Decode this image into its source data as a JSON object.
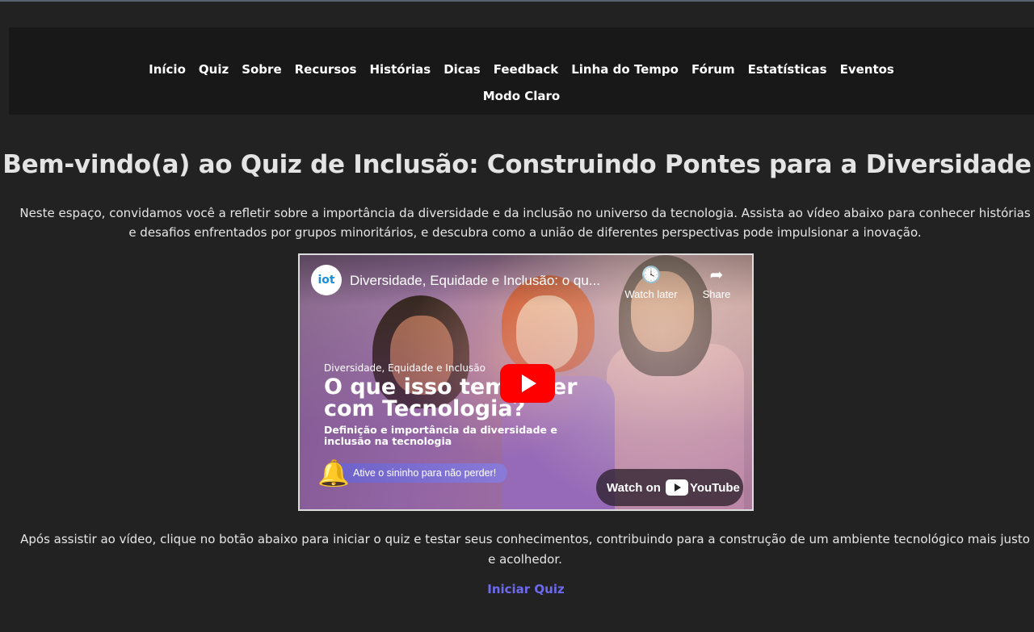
{
  "nav": {
    "items": [
      "Início",
      "Quiz",
      "Sobre",
      "Recursos",
      "Histórias",
      "Dicas",
      "Feedback",
      "Linha do Tempo",
      "Fórum",
      "Estatísticas",
      "Eventos"
    ],
    "mode_toggle": "Modo Claro"
  },
  "main": {
    "title": "Bem-vindo(a) ao Quiz de Inclusão: Construindo Pontes para a Diversidade",
    "intro": "Neste espaço, convidamos você a refletir sobre a importância da diversidade e da inclusão no universo da tecnologia. Assista ao vídeo abaixo para conhecer histórias e desafios enfrentados por grupos minoritários, e descubra como a união de diferentes perspectivas pode impulsionar a inovação.",
    "after_video": "Após assistir ao vídeo, clique no botão abaixo para iniciar o quiz e testar seus conhecimentos, contribuindo para a construção de um ambiente tecnológico mais justo e acolhedor.",
    "start_button": "Iniciar Quiz"
  },
  "video": {
    "channel_logo": "iot",
    "title": "Diversidade, Equidade e Inclusão: o qu...",
    "watch_later": "Watch later",
    "share": "Share",
    "thumb_subtitle": "Diversidade, Equidade e Inclusão",
    "thumb_line1": "O que isso tem a ver",
    "thumb_line2": "com Tecnologia?",
    "thumb_desc": "Definição e importância da diversidade e inclusão na tecnologia",
    "bell_text": "Ative o sininho para não perder!",
    "watch_on": "Watch on",
    "youtube": "YouTube"
  },
  "colors": {
    "background": "#222222",
    "nav_background": "#181818",
    "link_accent": "#6e6af0",
    "play_red": "#ff0000"
  }
}
